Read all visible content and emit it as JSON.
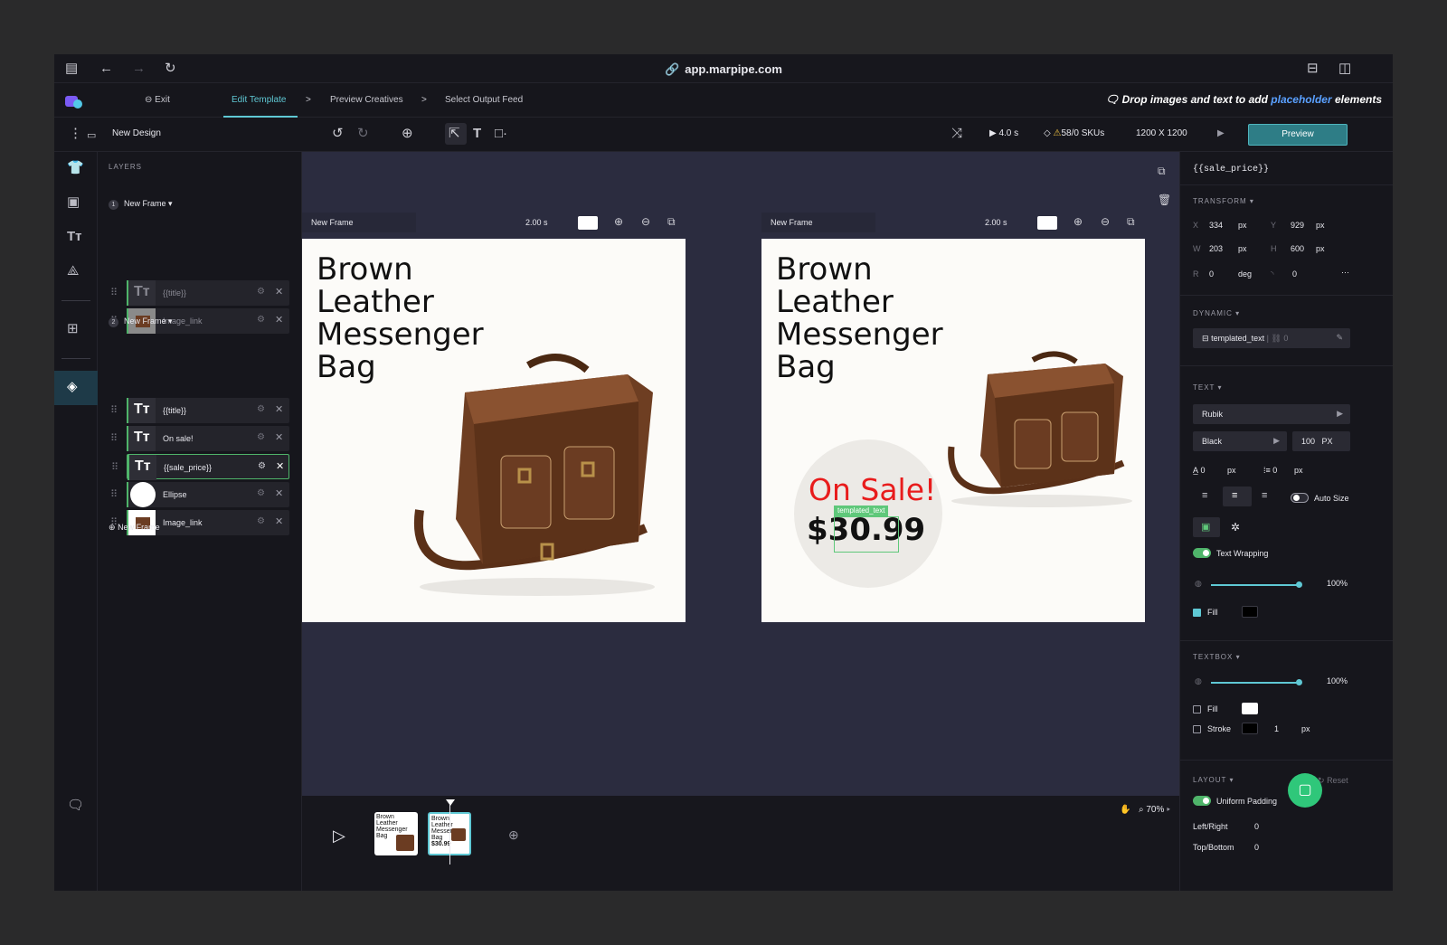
{
  "browser": {
    "url": "app.marpipe.com"
  },
  "nav": {
    "exit": "Exit",
    "steps": [
      "Edit Template",
      ">",
      "Preview Creatives",
      ">",
      "Select Output Feed"
    ],
    "hint_prefix": "Drop images and text to add ",
    "hint_link": "placeholder",
    "hint_suffix": " elements"
  },
  "toolbar": {
    "design_name": "New Design",
    "duration": "4.0 s",
    "skus": "58/0 SKUs",
    "size": "1200 X 1200",
    "preview": "Preview"
  },
  "layers": {
    "header": "LAYERS",
    "frames": [
      {
        "num": "1",
        "name": "New Frame",
        "items": [
          {
            "label": "{{title}}",
            "type": "text"
          },
          {
            "label": "Image_link",
            "type": "image"
          }
        ]
      },
      {
        "num": "2",
        "name": "New Frame",
        "items": [
          {
            "label": "{{title}}",
            "type": "text"
          },
          {
            "label": "On sale!",
            "type": "text"
          },
          {
            "label": "{{sale_price}}",
            "type": "text"
          },
          {
            "label": "Ellipse",
            "type": "ellipse"
          },
          {
            "label": "Image_link",
            "type": "image"
          }
        ]
      }
    ],
    "new_frame": "New Frame"
  },
  "canvas": {
    "frames": [
      {
        "name": "New Frame",
        "duration": "2.00 s",
        "title_lines": [
          "Brown",
          "Leather",
          "Messenger",
          "Bag"
        ]
      },
      {
        "name": "New Frame",
        "duration": "2.00 s",
        "title_lines": [
          "Brown",
          "Leather",
          "Messenger",
          "Bag"
        ],
        "sale": "On Sale!",
        "price": "$30.99",
        "tag": "templated_text"
      }
    ]
  },
  "timeline": {
    "thumb1_text": [
      "Brown",
      "Leather",
      "Messenger",
      "Bag"
    ],
    "thumb2_price": "$30.99",
    "zoom": "70%"
  },
  "props": {
    "title": "{{sale_price}}",
    "transform": {
      "header": "TRANSFORM ▾",
      "x_label": "X",
      "x": "334",
      "y_label": "Y",
      "y": "929",
      "w_label": "W",
      "w": "203",
      "h_label": "H",
      "h": "600",
      "r_label": "R",
      "r": "0",
      "deg": "deg",
      "corner": "0",
      "unit": "px"
    },
    "dynamic": {
      "header": "DYNAMIC ▾",
      "value": "templated_text",
      "count": "0"
    },
    "text": {
      "header": "TEXT ▾",
      "font": "Rubik",
      "weight": "Black",
      "size": "100",
      "size_unit": "PX",
      "letter": "0",
      "line": "0",
      "unit": "px",
      "auto_size": "Auto Size",
      "wrapping": "Text Wrapping",
      "opacity": "100%",
      "fill": "Fill"
    },
    "textbox": {
      "header": "TEXTBOX ▾",
      "opacity": "100%",
      "fill": "Fill",
      "stroke": "Stroke",
      "stroke_width": "1",
      "unit": "px"
    },
    "layout": {
      "header": "LAYOUT ▾",
      "reset": "Reset",
      "uniform": "Uniform Padding",
      "lr_label": "Left/Right",
      "lr": "0",
      "tb_label": "Top/Bottom",
      "tb": "0"
    }
  },
  "colors": {
    "accent": "#5fc8d4",
    "sale_red": "#e81c1c",
    "brand_purple": "#7a5af5",
    "green": "#4fb46a"
  }
}
